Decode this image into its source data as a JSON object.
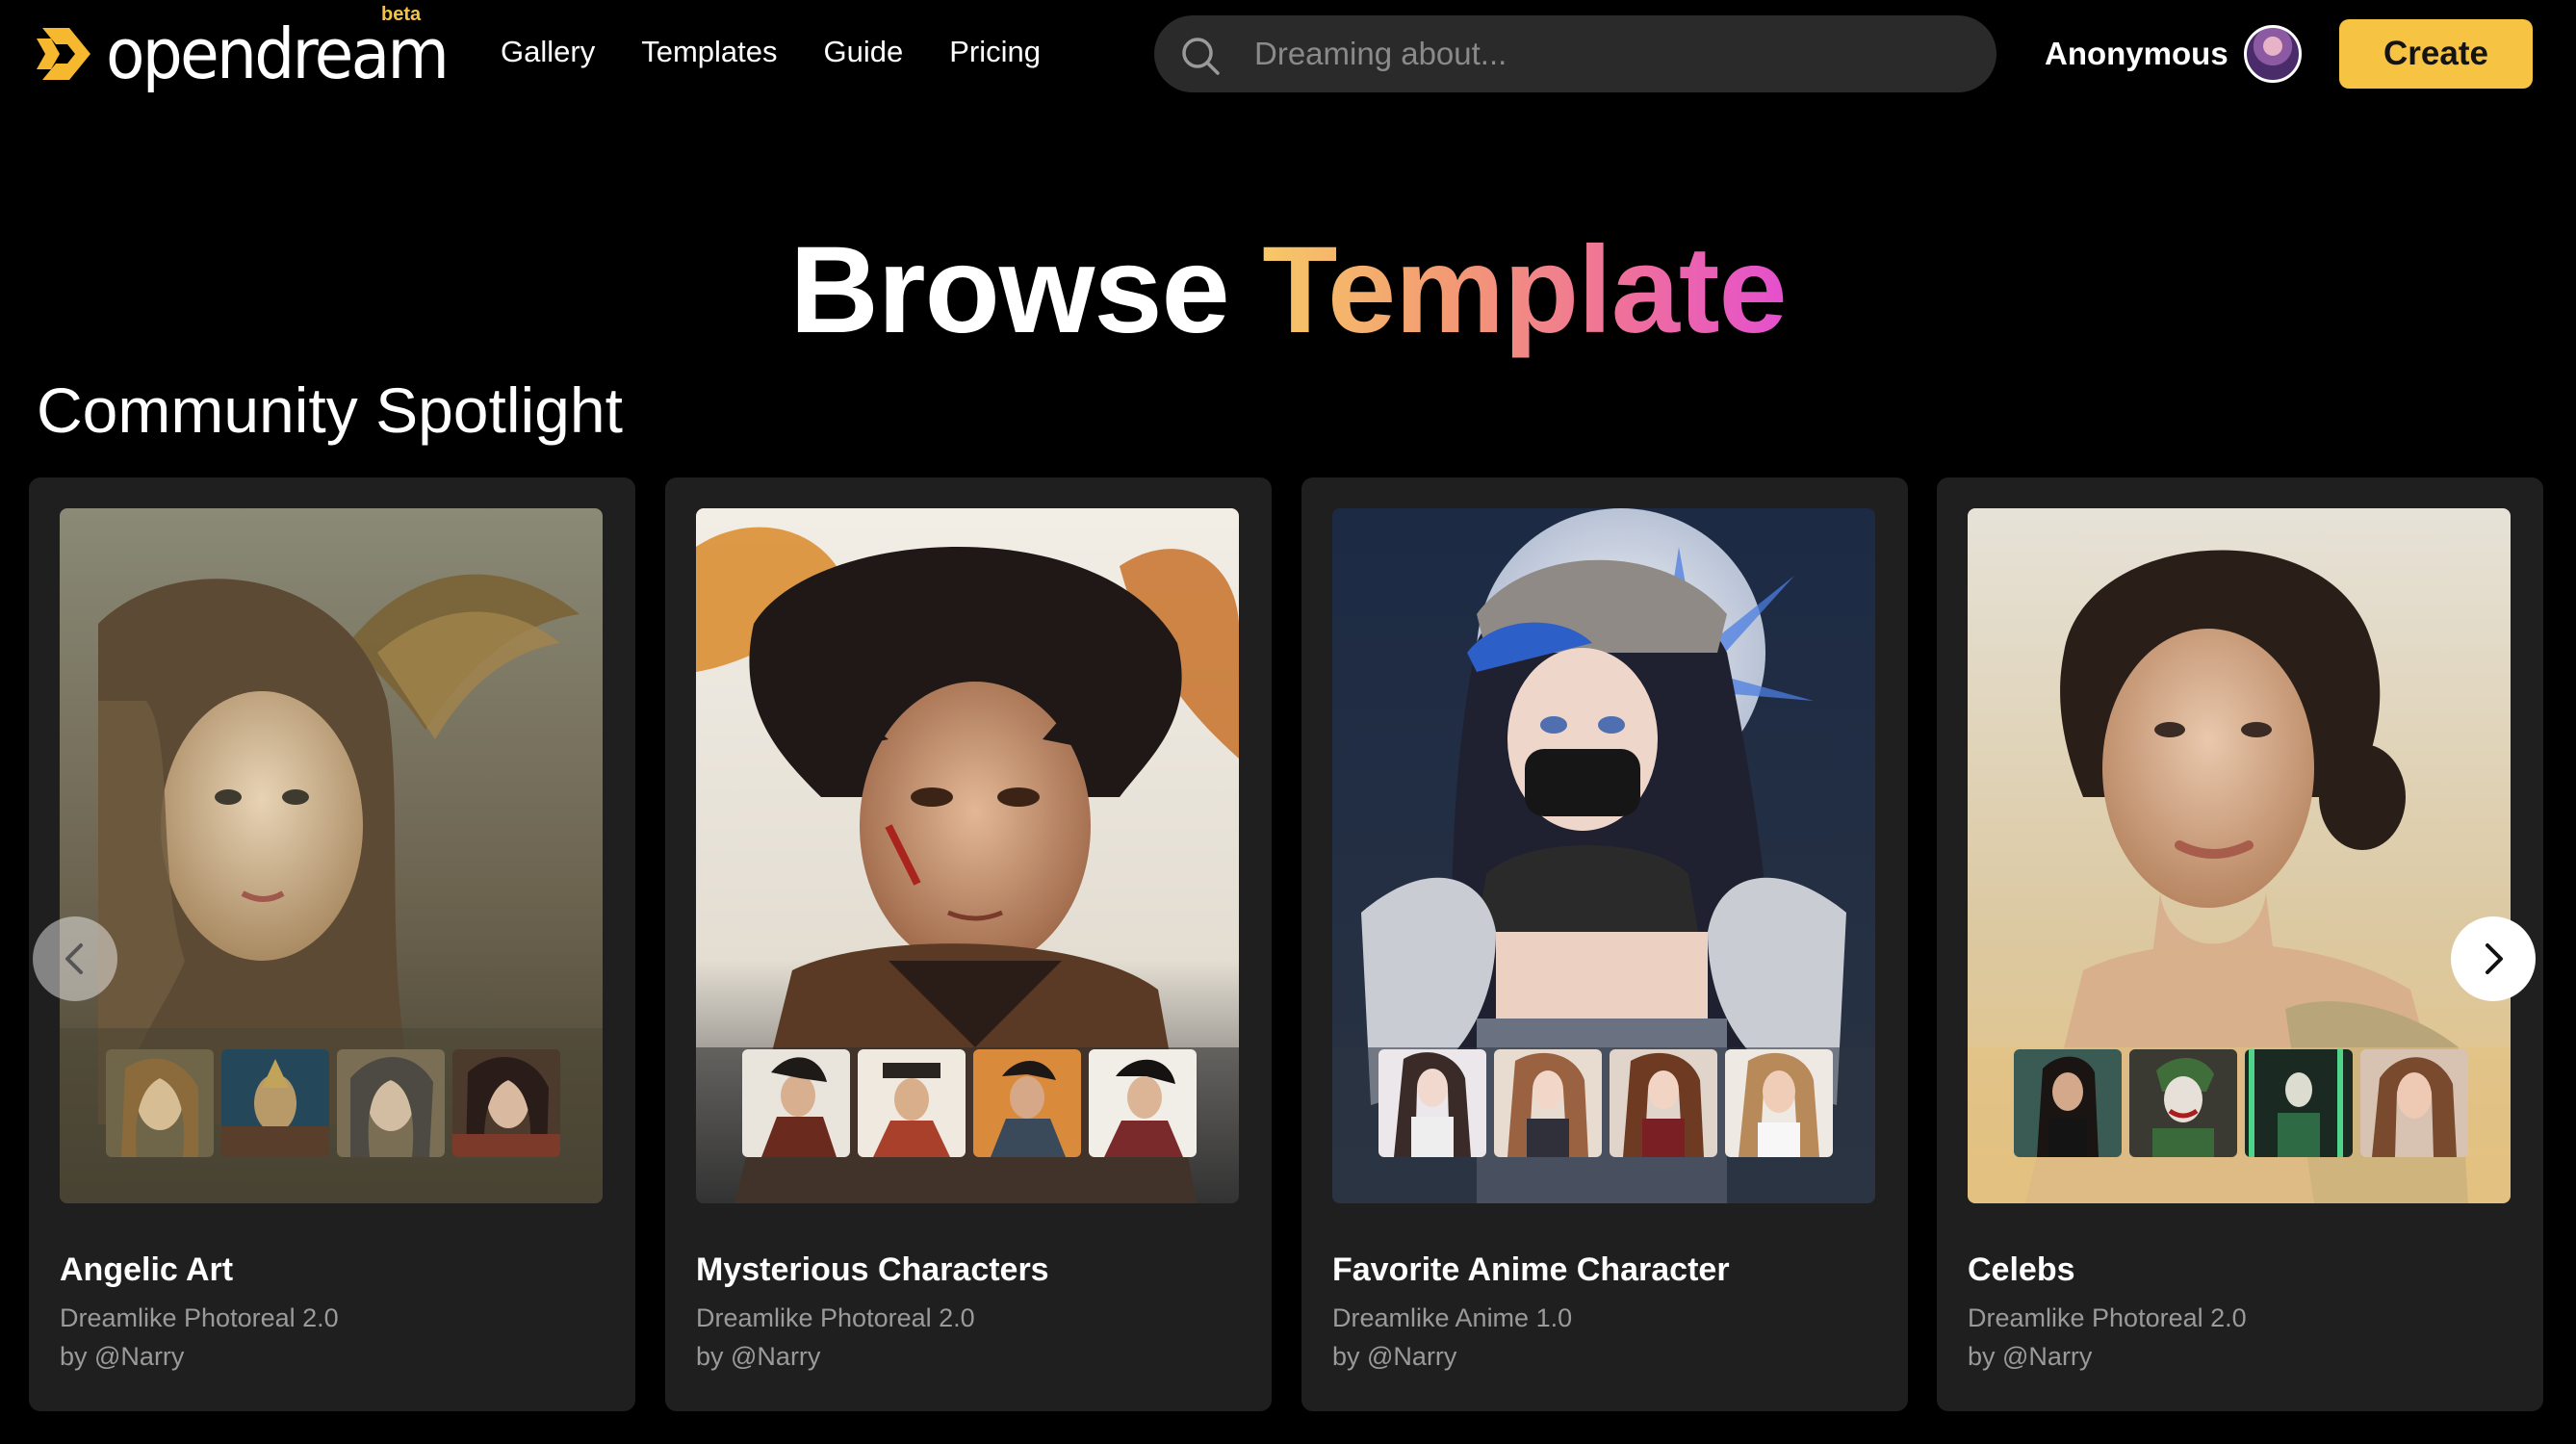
{
  "nav": {
    "logo_text": "opendream",
    "beta_badge": "beta",
    "links": [
      "Gallery",
      "Templates",
      "Guide",
      "Pricing"
    ],
    "search_placeholder": "Dreaming about...",
    "user_name": "Anonymous",
    "create_label": "Create"
  },
  "page": {
    "title_main": "Browse",
    "title_accent": "Template",
    "section_title": "Community Spotlight"
  },
  "cards": [
    {
      "name": "Angelic Art",
      "model": "Dreamlike Photoreal 2.0",
      "author": "by @Narry",
      "theme_color": "#4a4535"
    },
    {
      "name": "Mysterious Characters",
      "model": "Dreamlike Photoreal 2.0",
      "author": "by @Narry",
      "theme_color": "#2e2e2e"
    },
    {
      "name": "Favorite Anime Character",
      "model": "Dreamlike Anime 1.0",
      "author": "by @Narry",
      "theme_color": "#2b3444"
    },
    {
      "name": "Celebs",
      "model": "Dreamlike Photoreal 2.0",
      "author": "by @Narry",
      "theme_color": "#e3c17f"
    }
  ],
  "icons": {
    "logo": "opendream-logo-icon",
    "search": "search-icon",
    "prev": "chevron-left-icon",
    "next": "chevron-right-icon"
  },
  "colors": {
    "background": "#000000",
    "accent": "#f7c343",
    "card": "#1f1f1f",
    "muted_text": "#9a9a9a"
  }
}
